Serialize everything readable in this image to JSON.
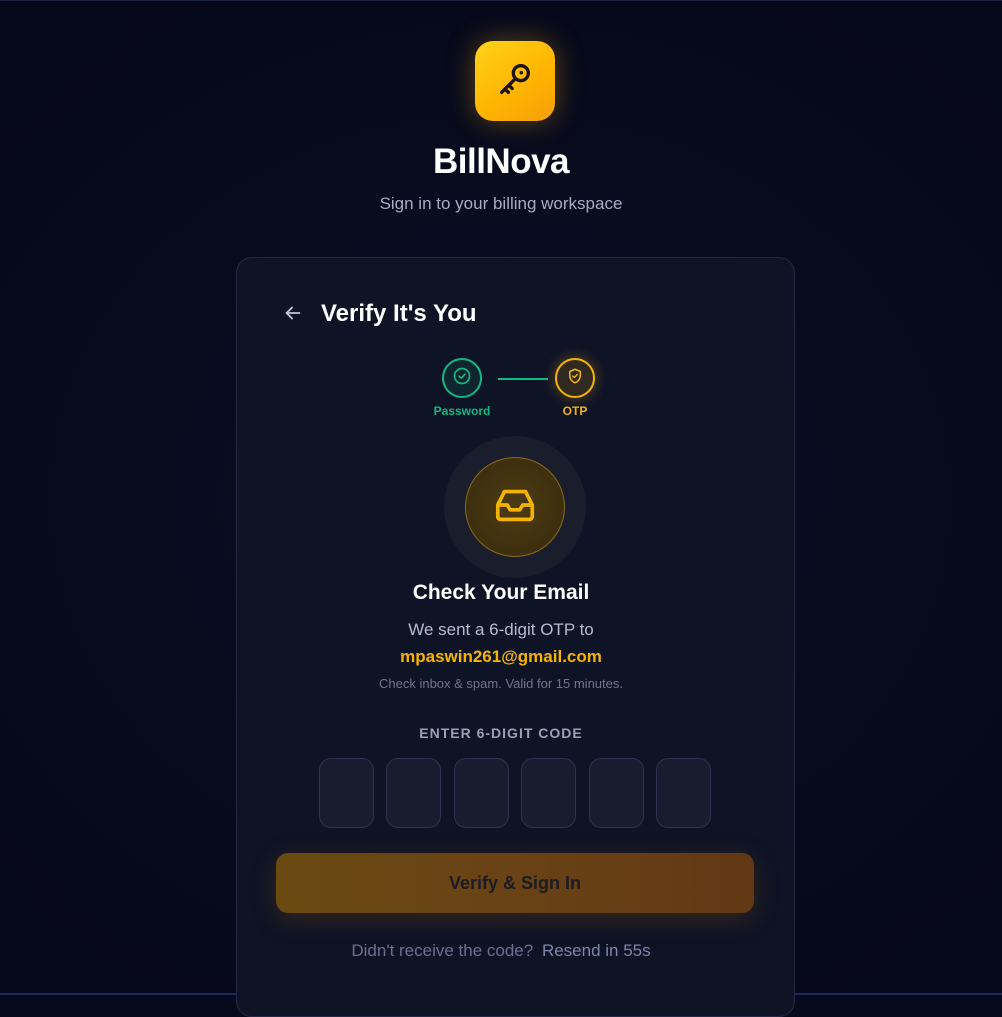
{
  "brand": {
    "name": "BillNova",
    "tagline": "Sign in to your billing workspace",
    "logo_icon": "key-icon",
    "accent_color": "#f5b400"
  },
  "card": {
    "back_icon": "arrow-left-icon",
    "title": "Verify It's You"
  },
  "stepper": {
    "steps": [
      {
        "label": "Password",
        "icon": "check-circle-icon",
        "status": "complete",
        "color": "#10b981"
      },
      {
        "label": "OTP",
        "icon": "shield-icon",
        "status": "active",
        "color": "#f5b400"
      }
    ]
  },
  "message": {
    "icon": "inbox-icon",
    "title": "Check Your Email",
    "sent_text": "We sent a 6-digit OTP to",
    "email": "mpaswin261@gmail.com",
    "hint": "Check inbox & spam. Valid for 15 minutes."
  },
  "otp": {
    "label": "ENTER 6-DIGIT CODE",
    "digits": [
      "",
      "",
      "",
      "",
      "",
      ""
    ]
  },
  "actions": {
    "verify_label": "Verify & Sign In",
    "resend_prefix": "Didn't receive the code?",
    "resend_label": "Resend in 55s"
  }
}
